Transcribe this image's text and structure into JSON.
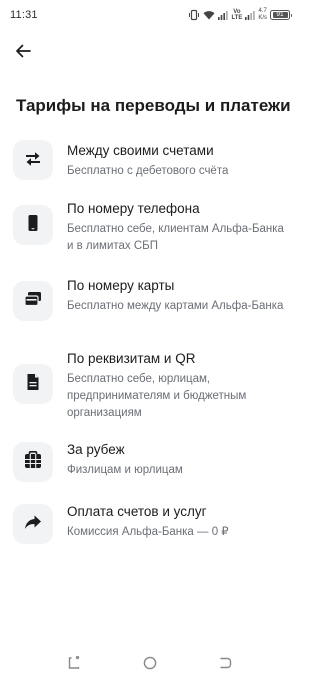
{
  "status_bar": {
    "time": "11:31",
    "net_top": "Vo",
    "net_bottom": "LTE",
    "speed_top": "4.7",
    "speed_bottom": "K/s",
    "battery": "91"
  },
  "header": {
    "title": "Тарифы на переводы и платежи"
  },
  "items": [
    {
      "icon": "transfer-arrows-icon",
      "title": "Между своими счетами",
      "subtitle": "Бесплатно с дебетового счёта"
    },
    {
      "icon": "phone-icon",
      "title": "По номеру телефона",
      "subtitle": "Бесплатно себе, клиентам Альфа-Банка и в лимитах СБП"
    },
    {
      "icon": "card-icon",
      "title": "По номеру карты",
      "subtitle": "Бесплатно между картами Альфа-Банка"
    },
    {
      "icon": "document-icon",
      "title": "По реквизитам и QR",
      "subtitle": "Бесплатно себе, юрлицам, предпринимателям и бюджетным организациям"
    },
    {
      "icon": "globe-icon",
      "title": "За рубеж",
      "subtitle": "Физлицам и юрлицам"
    },
    {
      "icon": "share-arrow-icon",
      "title": "Оплата счетов и услуг",
      "subtitle": "Комиссия Альфа-Банка — 0 ₽"
    }
  ],
  "colors": {
    "icon_background": "#f2f3f5",
    "title": "#1c1c1e",
    "subtitle": "#6b6e76"
  }
}
